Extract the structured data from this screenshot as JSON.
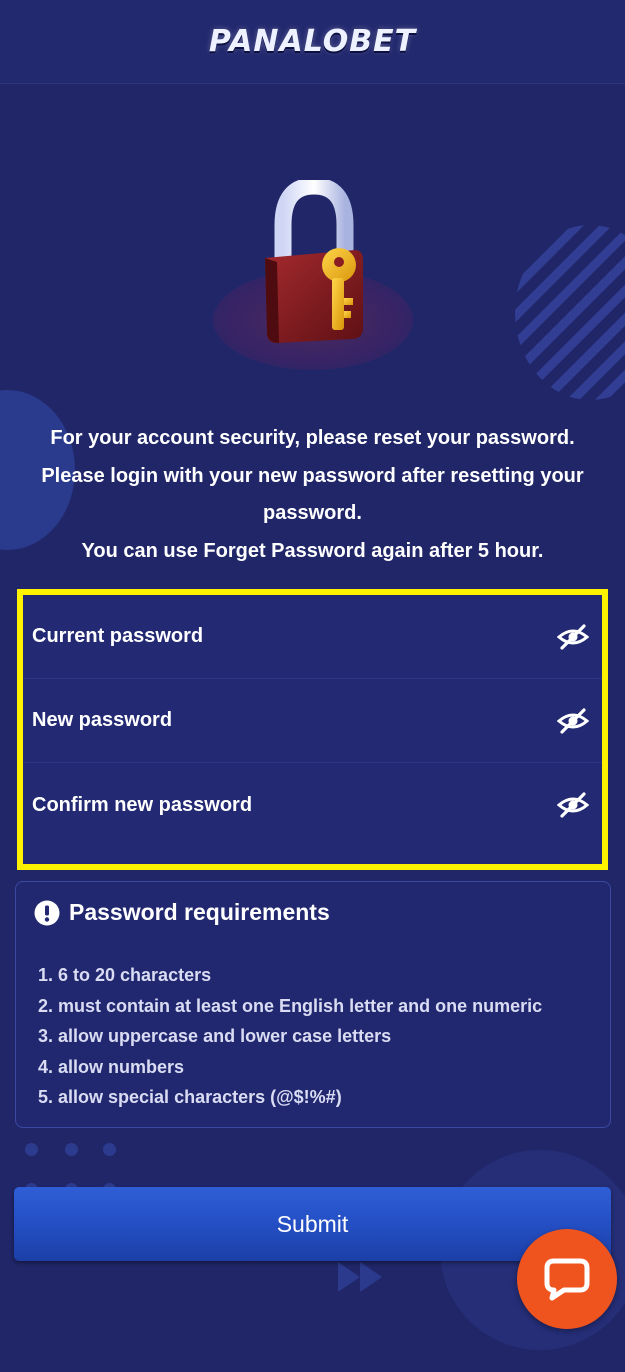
{
  "header": {
    "logo_text": "PANALOBET"
  },
  "message": {
    "line1": "For your account security, please reset your password.",
    "line2": "Please login with your new password after resetting your password.",
    "line3": "You can use Forget Password again after 5 hour."
  },
  "form": {
    "fields": [
      {
        "placeholder": "Current password",
        "value": "",
        "toggle_icon": "eye-off-icon"
      },
      {
        "placeholder": "New password",
        "value": "",
        "toggle_icon": "eye-off-icon"
      },
      {
        "placeholder": "Confirm new password",
        "value": "",
        "toggle_icon": "eye-off-icon"
      }
    ],
    "highlight_color": "#fff200"
  },
  "requirements": {
    "icon": "exclamation-circle-icon",
    "title": "Password requirements",
    "items": [
      "1. 6 to 20 characters",
      "2. must contain at least one English letter and one numeric",
      "3. allow uppercase and lower case letters",
      "4. allow numbers",
      "5. allow special characters (@$!%#)"
    ]
  },
  "submit": {
    "label": "Submit"
  },
  "chat": {
    "icon": "chat-bubble-icon",
    "color": "#f0541e"
  },
  "colors": {
    "background": "#202668",
    "button": "#2a57cc",
    "lock_body": "#8a1c22",
    "key": "#f0b81e"
  }
}
